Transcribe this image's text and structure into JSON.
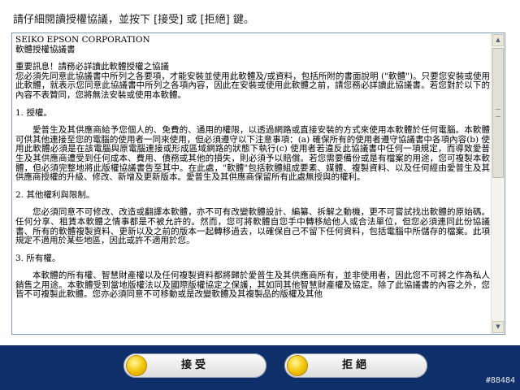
{
  "instruction": "請仔細閱讀授權協議，並按下 [接受] 或 [拒絕] 鍵。",
  "license": {
    "company": "SEIKO EPSON CORPORATION",
    "agreement_title": "軟體授權協議書",
    "notice_title": "重要訊息！請務必詳讀此軟體授權之協議",
    "notice_body": "您必須先同意此協議書中所列之各要項，才能安裝並使用此軟體及/或資料，包括所附的書面說明 (\"軟體\")。只要您安裝或使用此軟體，就表示您同意此協議書中所列之各項內容，因此在安裝或使用此軟體之前，請您務必詳讀此協議書。若您對於以下的內容不表贊同，您將無法安裝或使用本軟體。",
    "section1_title": "1. 授權。",
    "section1_body": "愛普生及其供應商給予您個人的、免費的、通用的權限，以透過網路或直接安裝的方式來使用本軟體於任何電腦。本軟體可供其他連接至您的電腦的使用者一同來使用，但必須遵守以下注意事項：(a) 確保所有的使用者遵守協議書中各項內容(b) 使用此軟體必須是在該電腦與原電腦連接或形成區域網路的狀態下執行(c) 使用者若違反此協議書中任何一項規定，而導致愛普生及其供應商遭受到任何成本、費用、債務或其他的損失，則必須予以賠償。若您需要備份或是有檔案的用途，您可複製本軟體，但必須完整地將此版權協議書告至其中。在此處，\"軟體\"包括軟體組成要素、媒體、複製資料、以及任何經由愛普生及其供應商授權的升級、修改、新增及更新版本。愛普生及其供應商保留所有此處無授與的權利。",
    "section2_title": "2. 其他權利與限制。",
    "section2_body": "您必須同意不可修改、改造或翻譯本軟體，亦不可有改變軟體設計、編纂、拆解之動機，更不可嘗試找出軟體的原始碼。任何分享、租賃本軟體之情事都是不被允許的。然而，您可將軟體自您手中轉移給他人或合法單位，但您必須連同此份協議書、所有的軟體複製資料、更新以及之前的版本一起轉移過去，以確保自己不留下任何資料，包括電腦中所儲存的檔案。此項規定不適用於某些地區，因此或許不適用於您。",
    "section3_title": "3. 所有權。",
    "section3_body": "本軟體的所有權、智慧財產權以及任何複製資料都將歸於愛普生及其供應商所有，並非使用者，因此您不可將之作為私人銷售之用途。本軟體受到當地版權法以及國際版權協定之保護，其如同其他智慧財產權及協定。除了此協議書的內容之外，您皆不可複製此軟體。您亦必須同意不可移動或是改變軟體及其複製品的版權及其他"
  },
  "buttons": {
    "accept_label": "接受",
    "decline_label": "拒絕"
  },
  "footer_code": "#88484",
  "colors": {
    "footer_bg": "#0f2f6a",
    "border": "#7f9db9",
    "icon_gold": "#f2c200"
  }
}
